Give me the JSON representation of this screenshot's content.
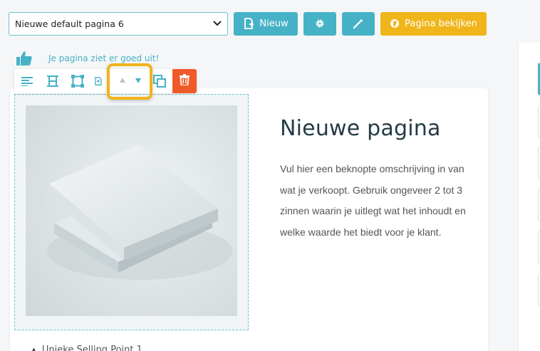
{
  "toolbar": {
    "page_select_value": "Nieuwe default pagina 6",
    "new_label": "Nieuw",
    "view_label": "Pagina bekijken"
  },
  "feedback": {
    "message": "Je pagina ziet er goed uit!"
  },
  "block_toolbar": {
    "icons": [
      "align-text-icon",
      "resize-height-icon",
      "resize-frame-icon",
      "add-block-icon",
      "move-up-icon",
      "move-down-icon",
      "duplicate-icon",
      "trash-icon"
    ]
  },
  "content": {
    "title": "Nieuwe pagina",
    "description": "Vul hier een beknopte omschrijving in van wat je verkoopt. Gebruik ongeveer 2 tot 3 zinnen waarin je uitlegt wat het inhoudt en welke waarde het biedt voor je klant.",
    "usp_first": "Unieke Selling Point 1"
  },
  "colors": {
    "teal": "#46b2c6",
    "yellow": "#f0b51a",
    "delete_red": "#f05a28",
    "heading": "#243b45"
  }
}
